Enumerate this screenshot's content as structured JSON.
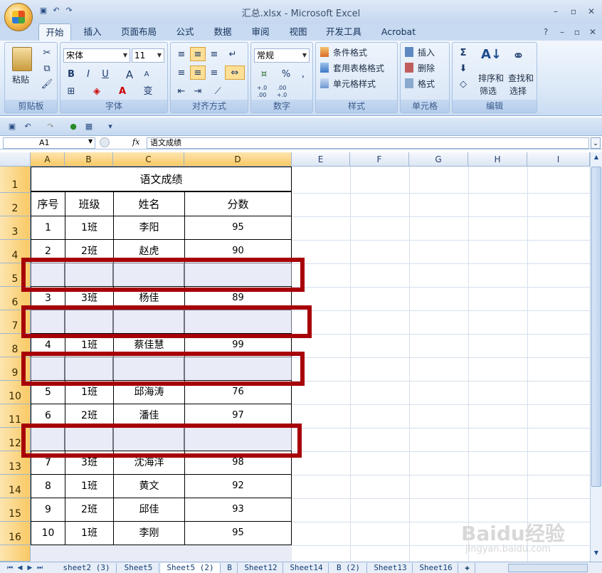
{
  "window": {
    "title": "汇总.xlsx - Microsoft Excel"
  },
  "tabs": [
    "开始",
    "插入",
    "页面布局",
    "公式",
    "数据",
    "审阅",
    "视图",
    "开发工具",
    "Acrobat"
  ],
  "ribbon": {
    "clipboard": {
      "paste": "粘贴",
      "label": "剪贴板"
    },
    "font": {
      "name": "宋体",
      "size": "11",
      "bold": "B",
      "italic": "I",
      "underline": "U",
      "grow": "A",
      "shrink": "A",
      "label": "字体",
      "phonetic": "变"
    },
    "alignment": {
      "label": "对齐方式"
    },
    "number": {
      "format": "常规",
      "percent": "%",
      "comma": ",",
      "inc_decimal": "+.0 .00",
      "dec_decimal": ".00 +.0",
      "label": "数字"
    },
    "styles": {
      "conditional": "条件格式",
      "table": "套用表格格式",
      "cell": "单元格样式",
      "label": "样式"
    },
    "cells": {
      "insert": "插入",
      "delete": "删除",
      "format": "格式",
      "label": "单元格"
    },
    "editing": {
      "sum": "Σ",
      "sort_line1": "排序和",
      "sort_line2": "筛选",
      "find_line1": "查找和",
      "find_line2": "选择",
      "label": "编辑"
    }
  },
  "formula_bar": {
    "name": "A1",
    "fx": "fx",
    "content": "语文成绩"
  },
  "columns": [
    "A",
    "B",
    "C",
    "D",
    "E",
    "F",
    "G",
    "H",
    "I"
  ],
  "rows": [
    "1",
    "2",
    "3",
    "4",
    "5",
    "6",
    "7",
    "8",
    "9",
    "10",
    "11",
    "12",
    "13",
    "14",
    "15",
    "16"
  ],
  "table": {
    "title": "语文成绩",
    "headers": [
      "序号",
      "班级",
      "姓名",
      "分数"
    ],
    "r3": [
      "1",
      "1班",
      "李阳",
      "95"
    ],
    "r4": [
      "2",
      "2班",
      "赵虎",
      "90"
    ],
    "r6": [
      "3",
      "3班",
      "杨佳",
      "89"
    ],
    "r8": [
      "4",
      "1班",
      "蔡佳慧",
      "99"
    ],
    "r10": [
      "5",
      "1班",
      "邱海涛",
      "76"
    ],
    "r11": [
      "6",
      "2班",
      "潘佳",
      "97"
    ],
    "r13": [
      "7",
      "3班",
      "沈海洋",
      "98"
    ],
    "r14": [
      "8",
      "1班",
      "黄文",
      "92"
    ],
    "r15": [
      "9",
      "2班",
      "邱佳",
      "93"
    ],
    "r16": [
      "10",
      "1班",
      "李刚",
      "95"
    ]
  },
  "sheets": [
    "sheet2 (3)",
    "Sheet5",
    "Sheet5 (2)",
    "B",
    "Sheet12",
    "Sheet14",
    "B (2)",
    "Sheet13",
    "Sheet16"
  ],
  "watermark": {
    "brand": "Baidu经验",
    "url": "jingyan.baidu.com"
  },
  "colors": {
    "highlight_box": "#a70008",
    "selected_header": "#f9c964"
  }
}
